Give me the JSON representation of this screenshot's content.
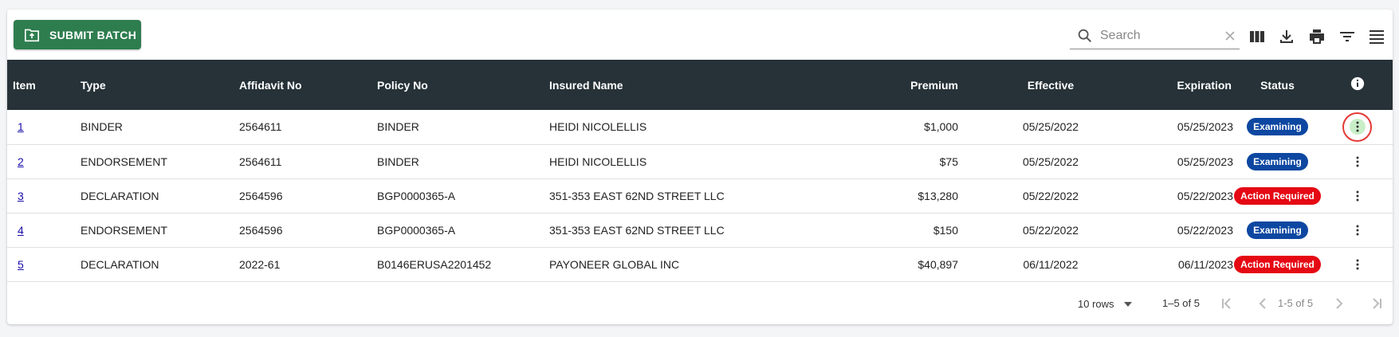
{
  "toolbar": {
    "submit_label": "SUBMIT BATCH",
    "submit_icon": "folder-upload-icon",
    "search_placeholder": "Search",
    "search_value": "",
    "icons": [
      "view-columns-icon",
      "download-icon",
      "print-icon",
      "filter-icon",
      "density-icon"
    ]
  },
  "columns": [
    "Item",
    "Type",
    "Affidavit No",
    "Policy No",
    "Insured Name",
    "Premium",
    "Effective",
    "Expiration",
    "Status"
  ],
  "rows": [
    {
      "item": "1",
      "type": "BINDER",
      "affidavit": "2564611",
      "policy": "BINDER",
      "insured": "HEIDI NICOLELLIS",
      "premium": "$1,000",
      "effective": "05/25/2022",
      "expiration": "05/25/2023",
      "status": "Examining"
    },
    {
      "item": "2",
      "type": "ENDORSEMENT",
      "affidavit": "2564611",
      "policy": "BINDER",
      "insured": "HEIDI NICOLELLIS",
      "premium": "$75",
      "effective": "05/25/2022",
      "expiration": "05/25/2023",
      "status": "Examining"
    },
    {
      "item": "3",
      "type": "DECLARATION",
      "affidavit": "2564596",
      "policy": "BGP0000365-A",
      "insured": "351-353 EAST 62ND STREET LLC",
      "premium": "$13,280",
      "effective": "05/22/2022",
      "expiration": "05/22/2023",
      "status": "Action Required"
    },
    {
      "item": "4",
      "type": "ENDORSEMENT",
      "affidavit": "2564596",
      "policy": "BGP0000365-A",
      "insured": "351-353 EAST 62ND STREET LLC",
      "premium": "$150",
      "effective": "05/22/2022",
      "expiration": "05/22/2023",
      "status": "Examining"
    },
    {
      "item": "5",
      "type": "DECLARATION",
      "affidavit": "2022-61",
      "policy": "B0146ERUSA2201452",
      "insured": "PAYONEER GLOBAL INC",
      "premium": "$40,897",
      "effective": "06/11/2022",
      "expiration": "06/11/2023",
      "status": "Action Required"
    }
  ],
  "footer": {
    "rows_per_page": "10 rows",
    "range_label": "1–5 of 5",
    "range_label_2": "1-5 of 5"
  },
  "colors": {
    "submit": "#2e7d4f",
    "header": "#263238",
    "examining": "#0d47a1",
    "action_required": "#e50914"
  }
}
